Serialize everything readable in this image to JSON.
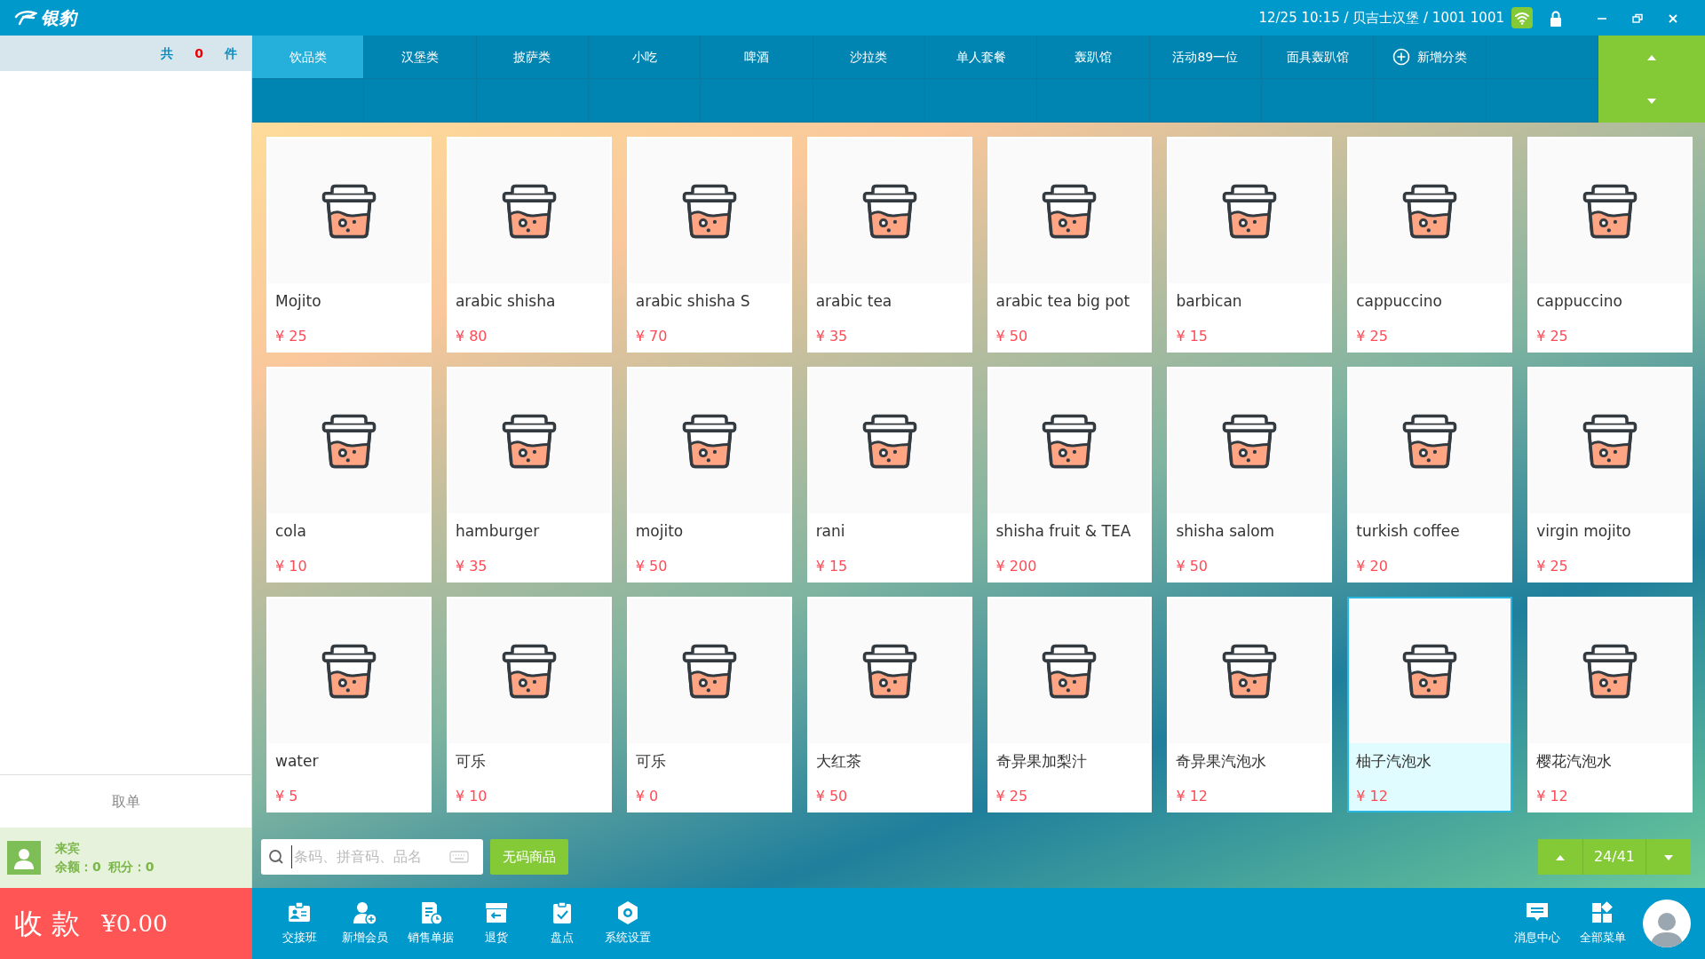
{
  "app": {
    "logo": "银豹",
    "status": "12/25 10:15 / 贝吉士汉堡 / 1001 1001"
  },
  "order_panel": {
    "count_prefix": "共",
    "count": "0",
    "count_suffix": "件",
    "retrieve": "取单",
    "member": {
      "name": "来宾",
      "balance": "余额：0",
      "points": "积分：0"
    },
    "checkout": {
      "label": "收 款",
      "amount": "¥0.00"
    }
  },
  "categories": [
    {
      "label": "饮品类",
      "selected": true,
      "kind": "category"
    },
    {
      "label": "汉堡类",
      "selected": false,
      "kind": "category"
    },
    {
      "label": "披萨类",
      "selected": false,
      "kind": "category"
    },
    {
      "label": "小吃",
      "selected": false,
      "kind": "category"
    },
    {
      "label": "啤酒",
      "selected": false,
      "kind": "category"
    },
    {
      "label": "沙拉类",
      "selected": false,
      "kind": "category"
    },
    {
      "label": "单人套餐",
      "selected": false,
      "kind": "category"
    },
    {
      "label": "轰趴馆",
      "selected": false,
      "kind": "category"
    },
    {
      "label": "活动89一位",
      "selected": false,
      "kind": "category"
    },
    {
      "label": "面具轰趴馆",
      "selected": false,
      "kind": "category"
    },
    {
      "label": "新增分类",
      "selected": false,
      "kind": "add"
    }
  ],
  "products": [
    {
      "name": "Mojito",
      "price": "¥ 25",
      "selected": false
    },
    {
      "name": "arabic shisha",
      "price": "¥ 80",
      "selected": false
    },
    {
      "name": "arabic shisha S",
      "price": "¥ 70",
      "selected": false
    },
    {
      "name": "arabic tea",
      "price": "¥ 35",
      "selected": false
    },
    {
      "name": "arabic tea big pot",
      "price": "¥ 50",
      "selected": false
    },
    {
      "name": "barbican",
      "price": "¥ 15",
      "selected": false
    },
    {
      "name": "cappuccino",
      "price": "¥ 25",
      "selected": false
    },
    {
      "name": "cappuccino",
      "price": "¥ 25",
      "selected": false
    },
    {
      "name": "cola",
      "price": "¥ 10",
      "selected": false
    },
    {
      "name": "hamburger",
      "price": "¥ 35",
      "selected": false
    },
    {
      "name": "mojito",
      "price": "¥ 50",
      "selected": false
    },
    {
      "name": "rani",
      "price": "¥ 15",
      "selected": false
    },
    {
      "name": "shisha fruit & TEA",
      "price": "¥ 200",
      "selected": false
    },
    {
      "name": "shisha salom",
      "price": "¥ 50",
      "selected": false
    },
    {
      "name": "turkish coffee",
      "price": "¥ 20",
      "selected": false
    },
    {
      "name": "virgin mojito",
      "price": "¥ 25",
      "selected": false
    },
    {
      "name": "water",
      "price": "¥ 5",
      "selected": false
    },
    {
      "name": "可乐",
      "price": "¥ 10",
      "selected": false
    },
    {
      "name": "可乐",
      "price": "¥ 0",
      "selected": false
    },
    {
      "name": "大红茶",
      "price": "¥ 50",
      "selected": false
    },
    {
      "name": "奇异果加梨汁",
      "price": "¥ 25",
      "selected": false
    },
    {
      "name": "奇异果汽泡水",
      "price": "¥ 12",
      "selected": false
    },
    {
      "name": "柚子汽泡水",
      "price": "¥ 12",
      "selected": true
    },
    {
      "name": "樱花汽泡水",
      "price": "¥ 12",
      "selected": false
    }
  ],
  "search": {
    "placeholder": "条码、拼音码、品名"
  },
  "no_code_button": "无码商品",
  "pager": "24/41",
  "toolbar": [
    {
      "label": "交接班",
      "kind": "shift"
    },
    {
      "label": "新增会员",
      "kind": "member"
    },
    {
      "label": "销售单据",
      "kind": "receipt"
    },
    {
      "label": "退货",
      "kind": "return"
    },
    {
      "label": "盘点",
      "kind": "stock"
    },
    {
      "label": "系统设置",
      "kind": "settings"
    }
  ],
  "toolbar_right": [
    {
      "label": "消息中心",
      "kind": "message"
    },
    {
      "label": "全部菜单",
      "kind": "menu"
    }
  ]
}
